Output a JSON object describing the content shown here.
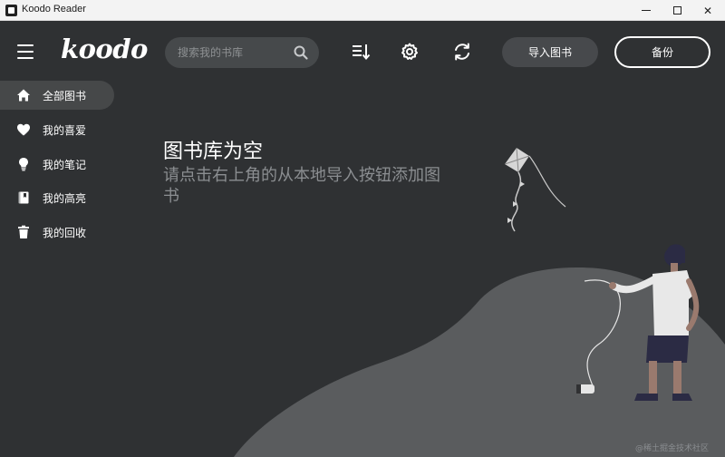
{
  "window": {
    "title": "Koodo Reader",
    "minimize_icon": "minimize-icon",
    "maximize_icon": "maximize-icon",
    "close_glyph": "✕"
  },
  "header": {
    "logo": "koodo",
    "search": {
      "placeholder": "搜索我的书库",
      "value": ""
    },
    "icons": [
      "menu-icon",
      "search-icon",
      "sort-icon",
      "gear-icon",
      "sync-icon"
    ],
    "import_label": "导入图书",
    "backup_label": "备份"
  },
  "sidebar": {
    "items": [
      {
        "label": "全部图书",
        "icon": "home-icon",
        "active": true
      },
      {
        "label": "我的喜爱",
        "icon": "heart-icon",
        "active": false
      },
      {
        "label": "我的笔记",
        "icon": "lightbulb-icon",
        "active": false
      },
      {
        "label": "我的高亮",
        "icon": "highlight-book-icon",
        "active": false
      },
      {
        "label": "我的回收",
        "icon": "trash-icon",
        "active": false
      }
    ]
  },
  "main": {
    "empty_title": "图书库为空",
    "empty_subtitle": "请点击右上角的从本地导入按钮添加图书"
  },
  "watermark": "@稀土掘金技术社区",
  "colors": {
    "background": "#2f3133",
    "active_item": "#464849",
    "hill": "#5a5c5e",
    "accent_text": "#ffffff",
    "muted_text": "#8b8e91"
  }
}
